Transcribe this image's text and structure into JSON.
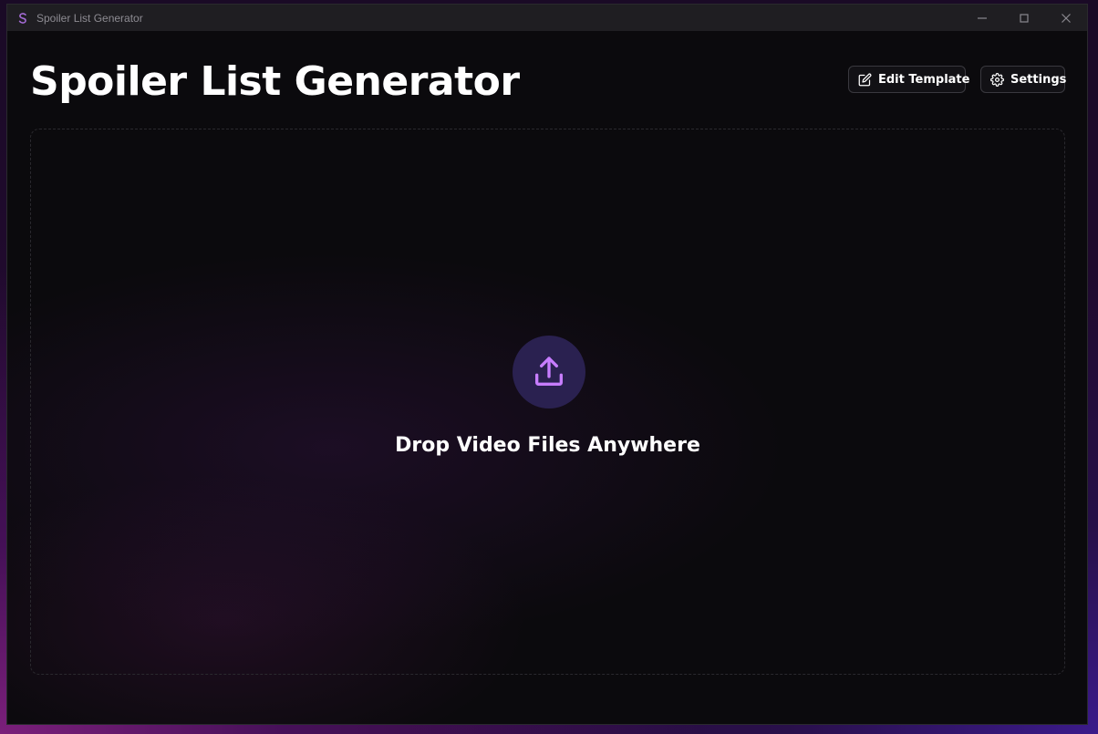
{
  "window": {
    "title": "Spoiler List Generator",
    "app_icon": "s-logo-icon",
    "controls": [
      "minimize-icon",
      "maximize-icon",
      "close-icon"
    ]
  },
  "header": {
    "title": "Spoiler List Generator",
    "edit_template_label": "Edit Template",
    "edit_template_icon": "edit-icon",
    "settings_label": "Settings",
    "settings_icon": "gear-icon"
  },
  "dropzone": {
    "icon": "upload-icon",
    "label": "Drop Video Files Anywhere"
  },
  "colors": {
    "accent": "#c77dff",
    "accent_bg": "#2a2150",
    "background": "#0b0a0d",
    "titlebar": "#1f1e22"
  }
}
